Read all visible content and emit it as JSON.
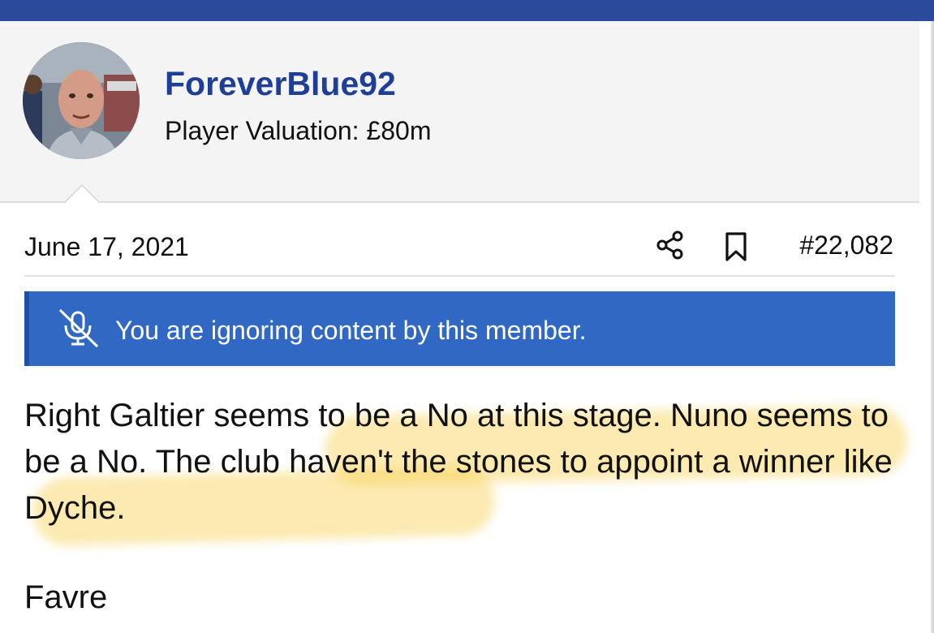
{
  "header": {
    "bar_color": "#2a4b9b"
  },
  "user_card": {
    "username": "ForeverBlue92",
    "valuation": "Player Valuation: £80m",
    "avatar_icon": "avatar-photo",
    "username_color": "#1f3f97",
    "background": "#f4f4f5"
  },
  "post": {
    "date": "June 17, 2021",
    "share_icon": "share-icon",
    "bookmark_icon": "bookmark-icon",
    "number": "#22,082",
    "ignore_notice": {
      "icon": "muted-microphone-icon",
      "text": "You are ignoring content by this member.",
      "color": "#3068c3"
    },
    "paragraphs": [
      "Right Galtier seems to be a No at this stage. Nuno seems to be a No. The club haven't the stones to appoint a winner like Dyche.",
      "Favre"
    ],
    "highlight_color": "#f7cd46"
  }
}
